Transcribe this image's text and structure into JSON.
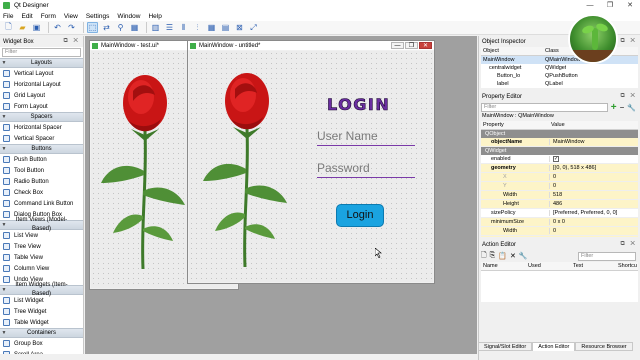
{
  "window": {
    "title": "Qt Designer",
    "controls": [
      "—",
      "❐",
      "✕"
    ]
  },
  "menu": [
    "File",
    "Edit",
    "Form",
    "View",
    "Settings",
    "Window",
    "Help"
  ],
  "widget_box": {
    "title": "Widget Box",
    "filter_placeholder": "Filter",
    "categories": [
      {
        "label": "Layouts",
        "items": [
          "Vertical Layout",
          "Horizontal Layout",
          "Grid Layout",
          "Form Layout"
        ]
      },
      {
        "label": "Spacers",
        "items": [
          "Horizontal Spacer",
          "Vertical Spacer"
        ]
      },
      {
        "label": "Buttons",
        "items": [
          "Push Button",
          "Tool Button",
          "Radio Button",
          "Check Box",
          "Command Link Button",
          "Dialog Button Box"
        ]
      },
      {
        "label": "Item Views (Model-Based)",
        "items": [
          "List View",
          "Tree View",
          "Table View",
          "Column View",
          "Undo View"
        ]
      },
      {
        "label": "Item Widgets (Item-Based)",
        "items": [
          "List Widget",
          "Tree Widget",
          "Table Widget"
        ]
      },
      {
        "label": "Containers",
        "items": [
          "Group Box",
          "Scroll Area"
        ]
      }
    ]
  },
  "subwindows": {
    "back_title": "MainWindow - test.ui*",
    "front_title": "MainWindow - untitled*",
    "login_label": "LOGIN",
    "username_text": "User Name",
    "password_text": "Password",
    "login_button": "Login"
  },
  "object_inspector": {
    "title": "Object Inspector",
    "filter_placeholder": "Filter",
    "columns": [
      "Object",
      "Class"
    ],
    "rows": [
      {
        "object": "MainWindow",
        "class": "QMainWindow",
        "selected": true
      },
      {
        "object": "centralwidget",
        "class": "QWidget",
        "selected": false
      },
      {
        "object": "Button_lo",
        "class": "QPushButton",
        "selected": false
      },
      {
        "object": "label",
        "class": "QLabel",
        "selected": false
      }
    ]
  },
  "property_editor": {
    "title": "Property Editor",
    "filter_placeholder": "Filter",
    "context": "MainWindow : QMainWindow",
    "columns": [
      "Property",
      "Value"
    ],
    "sections": [
      {
        "label": "QObject",
        "rows": [
          {
            "k": "objectName",
            "v": "MainWindow",
            "bold": true,
            "style": "y"
          }
        ]
      },
      {
        "label": "QWidget",
        "rows": [
          {
            "k": "enabled",
            "v": "✓",
            "style": "w"
          },
          {
            "k": "geometry",
            "v": "[(0, 0), 518 x 486]",
            "bold": true,
            "style": "y"
          },
          {
            "k": "X",
            "v": "0",
            "dis": true,
            "style": "y"
          },
          {
            "k": "Y",
            "v": "0",
            "dis": true,
            "style": "y"
          },
          {
            "k": "Width",
            "v": "518",
            "style": "y"
          },
          {
            "k": "Height",
            "v": "486",
            "style": "y"
          },
          {
            "k": "sizePolicy",
            "v": "[Preferred, Preferred, 0, 0]",
            "style": "w"
          },
          {
            "k": "minimumSize",
            "v": "0 x 0",
            "style": "y"
          },
          {
            "k": "Width",
            "v": "0",
            "style": "y"
          },
          {
            "k": "Height",
            "v": "0",
            "style": "y"
          },
          {
            "k": "maximumSize",
            "v": "16777215 x 16777215",
            "style": "y"
          }
        ]
      }
    ]
  },
  "action_editor": {
    "title": "Action Editor",
    "filter_placeholder": "Filter",
    "columns": [
      "Name",
      "Used",
      "Text",
      "Shortcu"
    ]
  },
  "bottom_tabs": [
    "Signal/Slot Editor",
    "Action Editor",
    "Resource Browser"
  ]
}
